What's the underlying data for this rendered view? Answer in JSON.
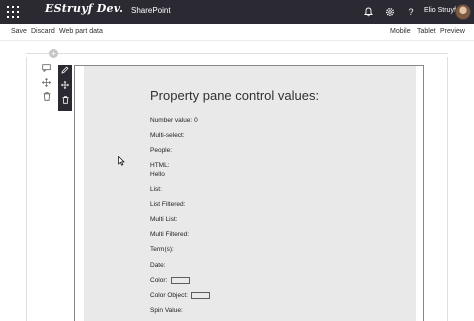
{
  "suitebar": {
    "brand": "EStruyf Dev.",
    "app_name": "SharePoint",
    "icons": [
      "waffle-icon",
      "bell-icon",
      "gear-icon",
      "help-icon"
    ],
    "user_name": "Elio Struyf"
  },
  "commandbar": {
    "save_label": "Save",
    "discard_label": "Discard",
    "webpart_data_label": "Web part data",
    "mobile_label": "Mobile",
    "tablet_label": "Tablet",
    "preview_label": "Preview"
  },
  "canvas": {
    "add_section_symbol": "+",
    "side_tools": [
      "comment-icon",
      "move-icon",
      "delete-icon"
    ],
    "webpart_tools": [
      "edit-icon",
      "move-icon",
      "delete-icon"
    ]
  },
  "webpart": {
    "title": "Property pane control values:",
    "number_value": "Number value: 0",
    "multi_select": "Multi-select:",
    "people": "People:",
    "html_label": "HTML:",
    "html_value": "Hello",
    "list": "List:",
    "list_filtered": "List Filtered:",
    "multi_list": "Multi List:",
    "multi_filtered": "Multi Filtered:",
    "terms": "Term(s):",
    "date": "Date:",
    "color": "Color:",
    "color_object": "Color Object:",
    "spin_value": "Spin Value:"
  }
}
